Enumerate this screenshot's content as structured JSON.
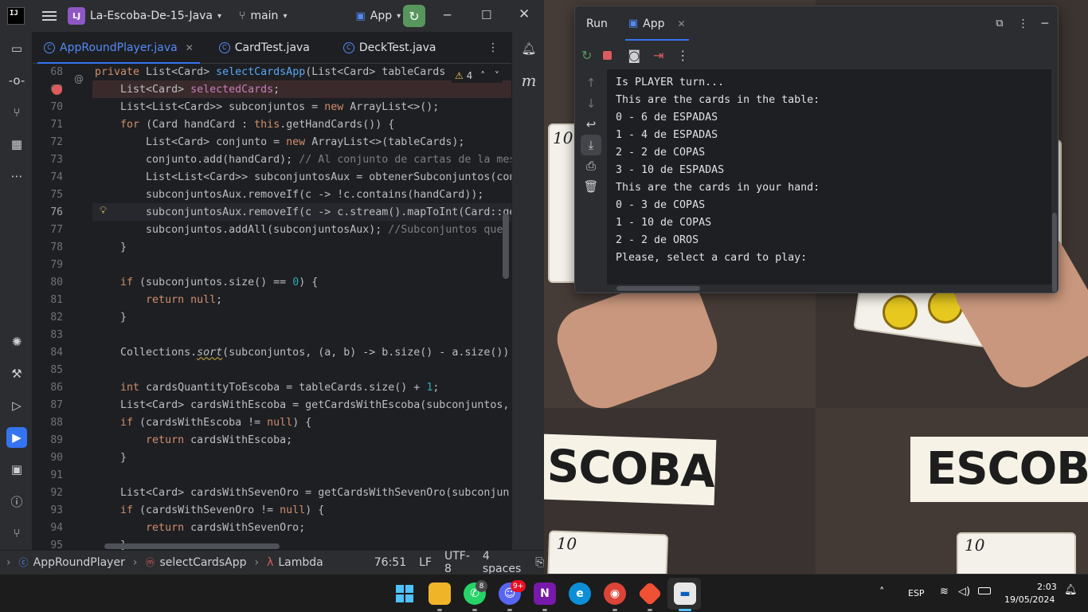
{
  "ide": {
    "logo": "IJ",
    "project_badge": "LJ",
    "project_name": "La-Escoba-De-15-Java",
    "branch": "main",
    "run_config": "App",
    "tabs": [
      {
        "label": "AppRoundPlayer.java",
        "active": true
      },
      {
        "label": "CardTest.java",
        "active": false
      },
      {
        "label": "DeckTest.java",
        "active": false
      }
    ],
    "warnings": "4",
    "line_numbers": [
      "68",
      "69",
      "70",
      "71",
      "72",
      "73",
      "74",
      "75",
      "76",
      "77",
      "78",
      "79",
      "80",
      "81",
      "82",
      "83",
      "84",
      "85",
      "86",
      "87",
      "88",
      "89",
      "90",
      "91",
      "92",
      "93",
      "94",
      "95"
    ],
    "code": [
      "private List<Card> selectCardsApp(List<Card> tableCards",
      "    List<Card> selectedCards;",
      "    List<List<Card>> subconjuntos = new ArrayList<>();",
      "    for (Card handCard : this.getHandCards()) {",
      "        List<Card> conjunto = new ArrayList<>(tableCards);",
      "        conjunto.add(handCard); // Al conjunto de cartas de la mes",
      "        List<List<Card>> subconjuntosAux = obtenerSubconjuntos(con",
      "        subconjuntosAux.removeIf(c -> !c.contains(handCard));",
      "        subconjuntosAux.removeIf(c -> c.stream().mapToInt(Card::ge",
      "        subconjuntos.addAll(subconjuntosAux); //Subconjuntos que",
      "    }",
      "",
      "    if (subconjuntos.size() == 0) {",
      "        return null;",
      "    }",
      "",
      "    Collections.sort(subconjuntos, (a, b) -> b.size() - a.size())",
      "",
      "    int cardsQuantityToEscoba = tableCards.size() + 1;",
      "    List<Card> cardsWithEscoba = getCardsWithEscoba(subconjuntos,",
      "    if (cardsWithEscoba != null) {",
      "        return cardsWithEscoba;",
      "    }",
      "",
      "    List<Card> cardsWithSevenOro = getCardsWithSevenOro(subconjun",
      "    if (cardsWithSevenOro != null) {",
      "        return cardsWithSevenOro;",
      "    }"
    ],
    "breadcrumb": [
      "AppRoundPlayer",
      "selectCardsApp",
      "Lambda"
    ],
    "status": {
      "position": "76:51",
      "line_sep": "LF",
      "encoding": "UTF-8",
      "indent": "4 spaces"
    }
  },
  "run": {
    "title": "Run",
    "tab": "App",
    "output": [
      "Is PLAYER turn...",
      "This are the cards in the table:",
      "0 - 6 de ESPADAS",
      "1 - 4 de ESPADAS",
      "2 - 2 de COPAS",
      "3 - 10 de ESPADAS",
      "This are the cards in your hand:",
      "0 - 3 de COPAS",
      "1 - 10 de COPAS",
      "2 - 2 de OROS",
      "Please, select a card to play:"
    ]
  },
  "wallpaper": {
    "banner_text": "SCOBA",
    "banner_text_2": "ESCOBA",
    "card_number": "10"
  },
  "taskbar": {
    "whatsapp_badge": "8",
    "discord_badge": "9+",
    "language": "ESP",
    "time": "2:03",
    "date": "19/05/2024"
  }
}
